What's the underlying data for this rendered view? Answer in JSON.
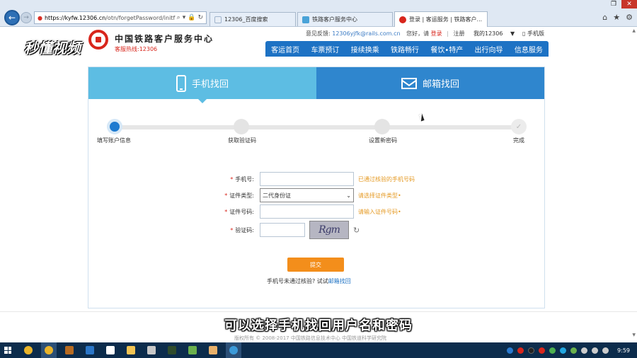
{
  "browser": {
    "url_host": "https://kyfw.12306.cn",
    "url_path": "/otn/forgetPassword/initf",
    "tabs": [
      {
        "label": "12306_百度搜索",
        "active": false,
        "color": "#e8eef6"
      },
      {
        "label": "铁路客户服务中心",
        "active": false,
        "color": "#4aa3d8"
      },
      {
        "label": "登录 | 客运服务 | 铁路客户...",
        "active": true,
        "color": "#d8261c"
      }
    ]
  },
  "site": {
    "name": "中国铁路客户服务中心",
    "hotline": "客服热线:12306",
    "feedback_label": "意见反馈:",
    "feedback_email": "12306yjfk@rails.com.cn",
    "greeting": "您好，请",
    "login": "登录",
    "register": "注册",
    "my_account": "我的12306",
    "mobile": "手机版",
    "nav": [
      "客运首页",
      "车票预订",
      "接续换乘",
      "铁路畅行",
      "餐饮•特产",
      "出行向导",
      "信息服务"
    ],
    "watermark": "秒懂视频"
  },
  "recover": {
    "tab_phone": "手机找回",
    "tab_email": "邮箱找回",
    "steps": [
      "填写账户信息",
      "获取验证码",
      "设置新密码",
      "完成"
    ],
    "fields": {
      "phone_label": "手机号:",
      "phone_hint": "已通过核验的手机号码",
      "id_type_label": "证件类型:",
      "id_type_value": "二代身份证",
      "id_type_hint": "请选择证件类型•",
      "id_number_label": "证件号码:",
      "id_number_hint": "请输入证件号码•",
      "captcha_label": "验证码:",
      "captcha_text": "Rgm"
    },
    "submit": "提交",
    "alt_prefix": "手机号未通过核验? 试试",
    "alt_link": "邮箱找回"
  },
  "footer": {
    "copyright": "版权所有 © 2008-2017 中国铁路信息技术中心 中国铁道科学研究院"
  },
  "subtitle": "可以选择手机找回用户名和密码",
  "taskbar": {
    "time": "9:59",
    "apps": [
      {
        "name": "chrome",
        "color": "#e9b42b"
      },
      {
        "name": "chrome-active",
        "color": "#e9b42b"
      },
      {
        "name": "app-brown",
        "color": "#b76b22"
      },
      {
        "name": "media-player",
        "color": "#2b76c8"
      },
      {
        "name": "game",
        "color": "#ffffff"
      },
      {
        "name": "file-explorer",
        "color": "#f3c453"
      },
      {
        "name": "pictures",
        "color": "#c8c8c8"
      },
      {
        "name": "illustrator",
        "color": "#2f4b2b"
      },
      {
        "name": "app-green",
        "color": "#6ab04c"
      },
      {
        "name": "paint",
        "color": "#e8b06a"
      },
      {
        "name": "ie",
        "color": "#3b9ad9"
      }
    ],
    "tray": [
      "#2a7ad0",
      "#d8261c",
      "#222222",
      "#d8261c",
      "#4caf50",
      "#21a6e0",
      "#6ab04c",
      "#cccccc",
      "#cccccc",
      "#cccccc"
    ]
  }
}
